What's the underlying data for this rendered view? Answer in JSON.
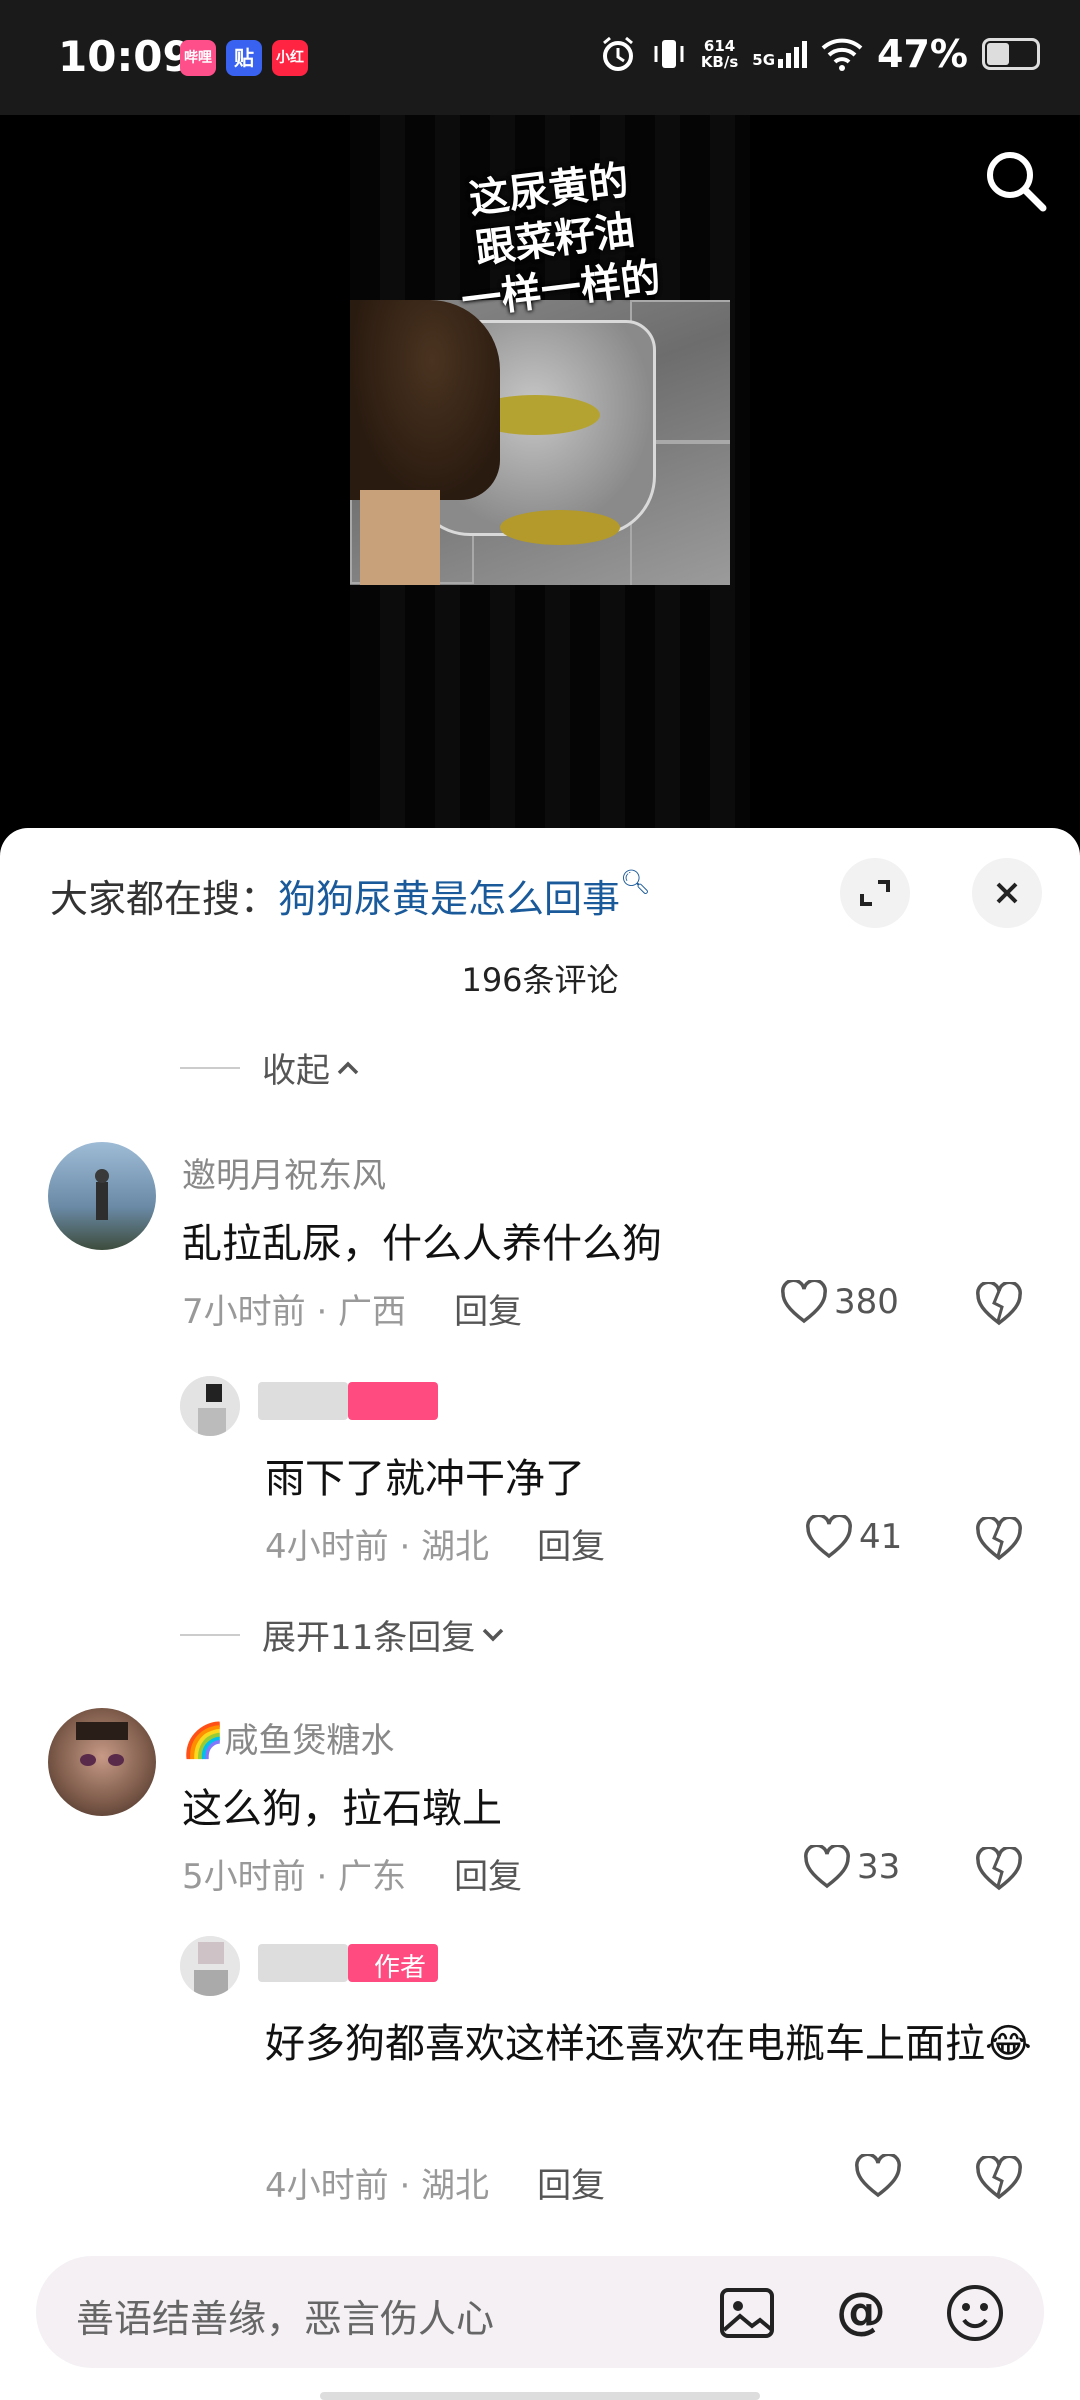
{
  "status_bar": {
    "time": "10:09",
    "app_icons": [
      "哔哩",
      "贴",
      "小红"
    ],
    "net_speed_value": "614",
    "net_speed_unit": "KB/s",
    "network": "5G",
    "battery": "47%"
  },
  "video": {
    "caption": "这尿黄的\n跟菜籽油\n一样一样的"
  },
  "comments_sheet": {
    "trending_prefix": "大家都在搜：",
    "trending_query": "狗狗尿黄是怎么回事",
    "count": "196条评论",
    "collapse_label": "收起",
    "expand_replies_label": "展开11条回复",
    "comments": [
      {
        "user": "邀明月祝东风",
        "text": "乱拉乱尿，什么人养什么狗",
        "time": "7小时前 · 广西",
        "reply": "回复",
        "likes": "380"
      },
      {
        "user": "",
        "text": "雨下了就冲干净了",
        "time": "4小时前 · 湖北",
        "reply": "回复",
        "likes": "41"
      },
      {
        "user": "🌈咸鱼煲糖水",
        "text": "这么狗，拉石墩上",
        "time": "5小时前 · 广东",
        "reply": "回复",
        "likes": "33"
      },
      {
        "user": "",
        "text": "好多狗都喜欢这样还喜欢在电瓶车上面拉😂",
        "time": "4小时前 · 湖北",
        "reply": "回复",
        "likes": ""
      }
    ],
    "author_badge": "作者"
  },
  "input_bar": {
    "placeholder": "善语结善缘，恶言伤人心"
  },
  "colors": {
    "accent_link": "#1a5a9a",
    "badge_pink": "#ff2c6a"
  }
}
